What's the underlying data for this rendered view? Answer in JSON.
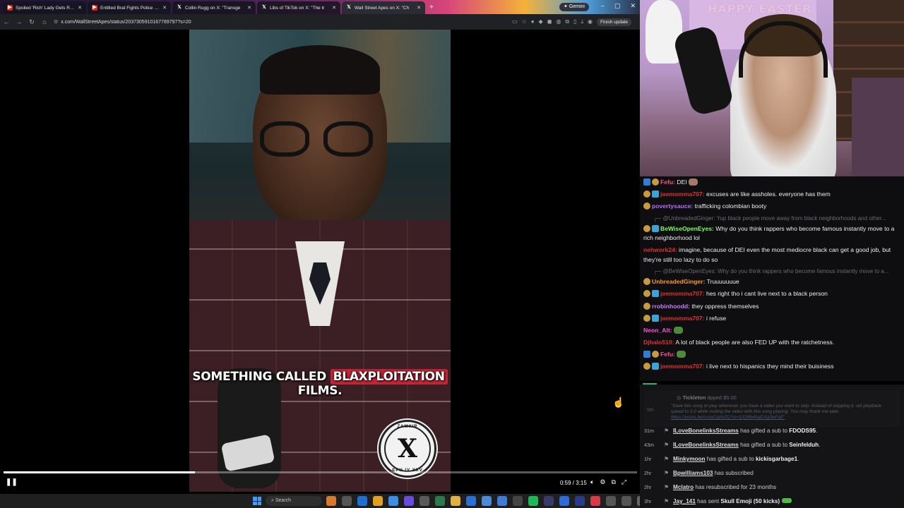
{
  "browser": {
    "tabs": [
      {
        "title": "Spoiled 'Rich' Lady Gets Reality",
        "favicon": "youtube-icon",
        "active": false
      },
      {
        "title": "Entitled Brat Fights Police Inste",
        "favicon": "youtube-icon",
        "active": false
      },
      {
        "title": "Collin Rugg on X: \"Transge",
        "favicon": "x-icon",
        "active": false
      },
      {
        "title": "Libs of TikTok on X: \"The tr",
        "favicon": "x-icon",
        "active": false
      },
      {
        "title": "Wall Street Apes on X: \"Ch",
        "favicon": "x-icon",
        "active": true
      }
    ],
    "new_tab_label": "+",
    "gemini_label": "Gemini",
    "url": "x.com/WallStreetApes/status/2037305910167789797?s=20",
    "finish_update_label": "Finish update"
  },
  "video": {
    "caption_before": "SOMETHING CALLED ",
    "caption_highlight": "BLAXPLOITATION",
    "caption_after": " FILMS.",
    "emblem_top": "ZAMXIR",
    "emblem_mark": "X",
    "emblem_bottom": "EPH IV XXV",
    "progress": 0.302,
    "time": "0:59 / 3:15"
  },
  "taskbar": {
    "search_label": "Search"
  },
  "webcam": {
    "banner": "HAPPY EASTER"
  },
  "chat": {
    "messages": [
      {
        "user": "Fefu",
        "color": "#ff4f8b",
        "badges": [
          "mod",
          "coin"
        ],
        "text": "DEI",
        "emote": "hands"
      },
      {
        "user": "joemomma707",
        "color": "#e0312f",
        "badges": [
          "coin",
          "sub"
        ],
        "text": "excuses are like assholes. everyone has them"
      },
      {
        "user": "povertysauce",
        "color": "#b96bff",
        "badges": [
          "coin"
        ],
        "text": "trafficking colombian booty"
      },
      {
        "reply": "@UnbreadedGinger: Yup black people move away from black neighborhoods and other..."
      },
      {
        "user": "BeWiseOpenEyes",
        "color": "#7cff5a",
        "badges": [
          "coin",
          "sub"
        ],
        "text": "Why do you think rappers who become famous instantly move to a rich neighborhood lol"
      },
      {
        "user": "nehwork24",
        "color": "#e0312f",
        "badges": [],
        "text": "imagine, because of DEI even the most mediocre black can get a good job, but they're still too lazy to do so"
      },
      {
        "reply": "@BeWiseOpenEyes: Why do you think rappers who become famous instantly move to a..."
      },
      {
        "user": "UnbreadedGinger",
        "color": "#ff9a1f",
        "badges": [
          "coin"
        ],
        "text": "Truuuuuuue"
      },
      {
        "user": "joemomma707",
        "color": "#e0312f",
        "badges": [
          "coin",
          "sub"
        ],
        "text": "hes right tho i cant live next to a black person"
      },
      {
        "user": "rrobinhoodd",
        "color": "#c77dff",
        "badges": [
          "coin"
        ],
        "text": "they oppress themselves"
      },
      {
        "user": "joemomma707",
        "color": "#e0312f",
        "badges": [
          "coin",
          "sub"
        ],
        "text": "i refuse"
      },
      {
        "user": "Neon_Alt",
        "color": "#ff4fd8",
        "badges": [],
        "text": "",
        "emote": "frog"
      },
      {
        "user": "Djhalo510",
        "color": "#e0312f",
        "badges": [],
        "text": "A lot of black people are also FED UP with the ratchetness."
      },
      {
        "user": "Fefu",
        "color": "#ff4f8b",
        "badges": [
          "mod",
          "coin"
        ],
        "text": "",
        "emote": "frog"
      },
      {
        "user": "joemomma707",
        "color": "#e0312f",
        "badges": [
          "coin",
          "sub"
        ],
        "text": "i live next to hispanics they mind their buisiness"
      }
    ]
  },
  "events": {
    "tip": {
      "user": "Tickleton",
      "action": "tipped",
      "amount": "$5.00",
      "ago": "5m",
      "note": "\"Save this song to play whenever you have a video you want to skip. Instead of skipping it, set playback speed to 2.0 while muting the video with this song playing. You may thank me later.",
      "link": "https://youtu.be/cscgCgzhZQ?si=3JQ8b4AqDXg3wFa5\""
    },
    "items": [
      {
        "ago": "31m",
        "user": "ILoveBonelinksStreams",
        "text": " has gifted a sub to ",
        "target": "FDODS95",
        "tail": "."
      },
      {
        "ago": "43m",
        "user": "ILoveBonelinksStreams",
        "text": " has gifted a sub to ",
        "target": "Seinfelduh",
        "tail": "."
      },
      {
        "ago": "1hr",
        "user": "Minkymoon",
        "text": " has gifted a sub to ",
        "target": "kickisgarbage1",
        "tail": "."
      },
      {
        "ago": "2hr",
        "user": "Bpwilliams103",
        "text": " has subscribed",
        "target": "",
        "tail": ""
      },
      {
        "ago": "2hr",
        "user": "Mclatro",
        "text": " has resubscribed for 23 months",
        "target": "",
        "tail": ""
      },
      {
        "ago": "3hr",
        "user": "Jay_141",
        "text": " has sent ",
        "target": "Skull Emoji (50 kicks)",
        "tail": ""
      }
    ]
  }
}
